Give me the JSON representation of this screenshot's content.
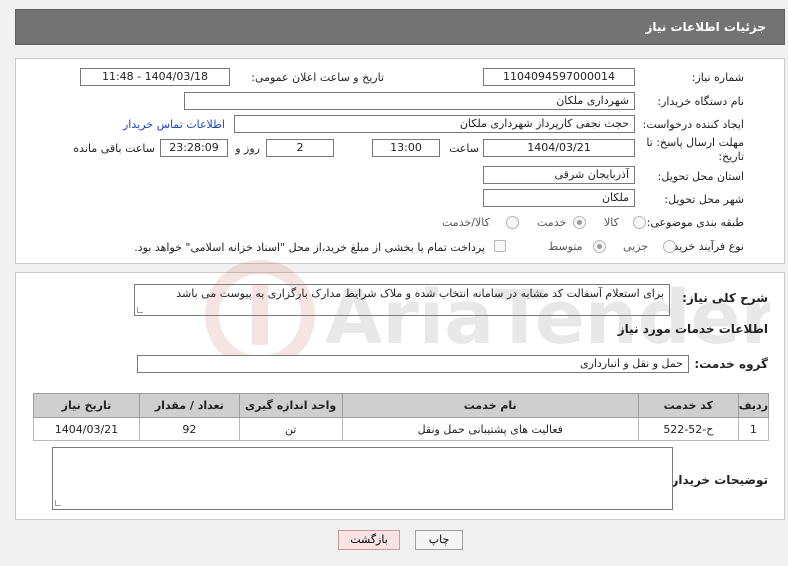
{
  "header": {
    "title": "جزئیات اطلاعات نیاز"
  },
  "form": {
    "need_number": {
      "label": "شماره نیاز:",
      "value": "1104094597000014"
    },
    "announce_datetime": {
      "label": "تاریخ و ساعت اعلان عمومی:",
      "value": "1404/03/18 - 11:48"
    },
    "buyer_org": {
      "label": "نام دستگاه خریدار:",
      "value": "شهرداری ملکان"
    },
    "requester": {
      "label": "ایجاد کننده درخواست:",
      "value": "حجت نجفی کارپرداز شهرداری ملکان",
      "contact_link": "اطلاعات تماس خریدار"
    },
    "deadline": {
      "label": "مهلت ارسال پاسخ: تا تاریخ:",
      "date": "1404/03/21",
      "time_label": "ساعت",
      "time": "13:00",
      "days": "2",
      "days_label": "روز و",
      "remaining": "23:28:09",
      "remaining_label": "ساعت باقی مانده"
    },
    "province": {
      "label": "استان محل تحویل:",
      "value": "آذربایجان شرقی"
    },
    "city": {
      "label": "شهر محل تحویل:",
      "value": "ملکان"
    },
    "category": {
      "label": "طبقه بندی موضوعی:",
      "options": [
        "کالا",
        "خدمت",
        "کالا/خدمت"
      ],
      "selected": "خدمت"
    },
    "process": {
      "label": "نوع فرآیند خرید :",
      "options": [
        "جزیی",
        "متوسط"
      ],
      "selected": "متوسط",
      "note": "پرداخت تمام یا بخشی از مبلغ خرید،از محل \"اسناد خزانه اسلامی\" خواهد بود."
    }
  },
  "description": {
    "label": "شرح کلی نیاز:",
    "value": "برای استعلام آسفالت کد مشابه در سامانه انتخاب شده و ملاک شرایط مدارک بارگزاری  به  پیوست می باشد"
  },
  "services": {
    "section_title": "اطلاعات خدمات مورد نیاز",
    "group_label": "گروه خدمت:",
    "group_value": "حمل و نقل و انبارداری",
    "columns": [
      "ردیف",
      "کد خدمت",
      "نام خدمت",
      "واحد اندازه گیری",
      "تعداد / مقدار",
      "تاریخ نیاز"
    ],
    "rows": [
      {
        "row": "1",
        "code": "ح-52-522",
        "name": "فعالیت های پشتیبانی حمل ونقل",
        "unit": "تن",
        "qty": "92",
        "date": "1404/03/21"
      }
    ]
  },
  "buyer_notes": {
    "label": "توضیحات خریدار:",
    "value": ""
  },
  "buttons": {
    "print": "چاپ",
    "back": "بازگشت"
  },
  "watermark": {
    "text": "AriaTender.net"
  },
  "colors": {
    "header_bg": "#737373",
    "link": "#1c47b8",
    "table_header": "#cfcfcf",
    "back_button": "#fbe3e3"
  }
}
